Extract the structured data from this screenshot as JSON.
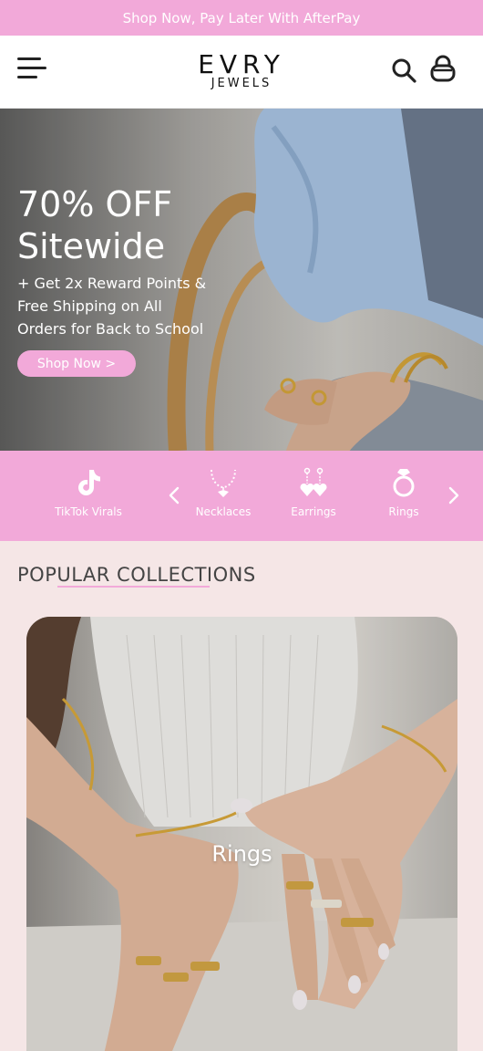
{
  "announcement": "Shop Now, Pay Later With AfterPay",
  "header": {
    "logo_top": "EVRY",
    "logo_bottom": "JEWELS",
    "menu_icon": "hamburger-menu-icon",
    "search_icon": "search-icon",
    "cart_icon": "shopping-bag-icon"
  },
  "hero": {
    "title_line1": "70% OFF",
    "title_line2": "Sitewide",
    "sub_line1": "+ Get 2x Reward Points &",
    "sub_line2": "Free Shipping on All",
    "sub_line3": "Orders for Back to School",
    "cta": "Shop Now >"
  },
  "categories": {
    "items": [
      {
        "label": "TikTok Virals",
        "icon": "tiktok-icon"
      },
      {
        "label": "Necklaces",
        "icon": "necklace-icon"
      },
      {
        "label": "Earrings",
        "icon": "earrings-icon"
      },
      {
        "label": "Rings",
        "icon": "ring-icon"
      }
    ],
    "prev_icon": "chevron-left-icon",
    "next_icon": "chevron-right-icon"
  },
  "popular": {
    "title": "POPULAR  COLLECTIONS",
    "cards": [
      {
        "label": "Rings"
      }
    ]
  },
  "colors": {
    "accent_pink": "#f2a9d9",
    "background": "#f5e6e6",
    "header_bg": "#ffffff"
  }
}
